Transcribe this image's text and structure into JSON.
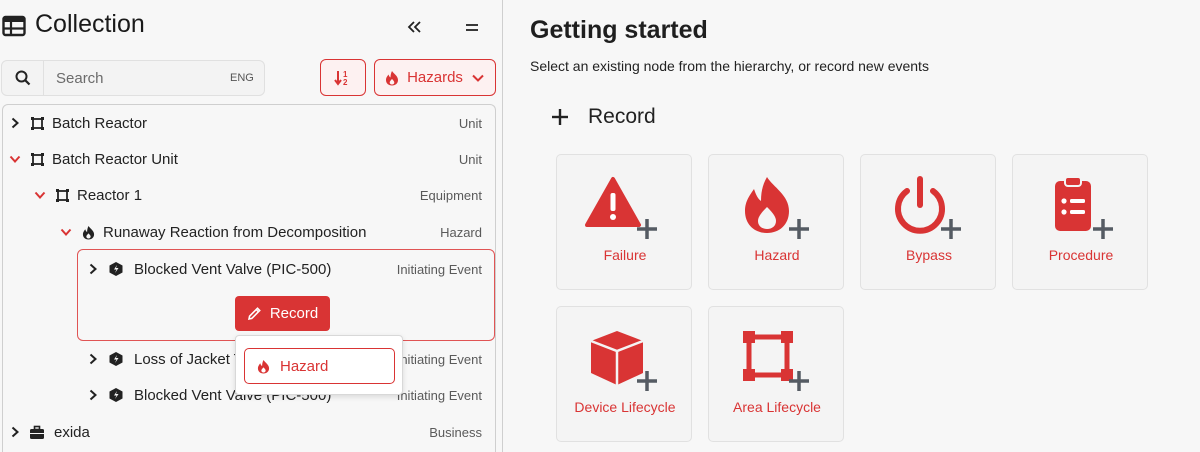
{
  "collection": {
    "title": "Collection",
    "search_placeholder": "Search",
    "lang": "ENG",
    "filter_label": "Hazards"
  },
  "tree": {
    "rows": [
      {
        "label": "Batch Reactor",
        "type": "Unit",
        "expanded": false,
        "icon": "unit-icon"
      },
      {
        "label": "Batch Reactor Unit",
        "type": "Unit",
        "expanded": true,
        "icon": "unit-icon"
      },
      {
        "label": "Reactor 1",
        "type": "Equipment",
        "expanded": true,
        "icon": "equipment-icon"
      },
      {
        "label": "Runaway Reaction from Decomposition",
        "type": "Hazard",
        "expanded": true,
        "icon": "hazard-icon"
      },
      {
        "label": "Blocked Vent Valve (PIC-500)",
        "type": "Initiating Event",
        "expanded": false,
        "icon": "initiating-event-icon"
      },
      {
        "label": "Loss of Jacket Te",
        "type": "Initiating Event",
        "expanded": false,
        "icon": "initiating-event-icon"
      },
      {
        "label": "Blocked Vent Valve (PIC-500)",
        "type": "Initiating Event",
        "expanded": false,
        "icon": "initiating-event-icon"
      },
      {
        "label": "exida",
        "type": "Business",
        "expanded": false,
        "icon": "business-icon"
      }
    ],
    "record_button": "Record",
    "popup_item": "Hazard"
  },
  "main": {
    "title": "Getting started",
    "subtitle": "Select an existing node from the hierarchy, or record new events",
    "record_heading": "Record",
    "cards": [
      {
        "label": "Failure",
        "icon": "warning-icon"
      },
      {
        "label": "Hazard",
        "icon": "flame-icon"
      },
      {
        "label": "Bypass",
        "icon": "power-icon"
      },
      {
        "label": "Procedure",
        "icon": "clipboard-icon"
      },
      {
        "label": "Device Lifecycle",
        "icon": "cube-icon"
      },
      {
        "label": "Area Lifecycle",
        "icon": "area-icon"
      }
    ]
  },
  "colors": {
    "accent": "#d93434",
    "plus": "#555b63"
  }
}
